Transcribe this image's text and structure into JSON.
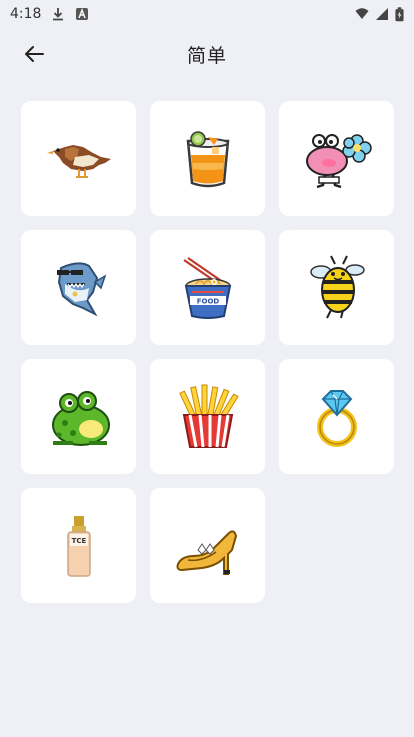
{
  "status": {
    "time": "4:18"
  },
  "header": {
    "title": "简单"
  },
  "items": [
    {
      "name": "bird"
    },
    {
      "name": "orange-drink"
    },
    {
      "name": "pink-flower-creature"
    },
    {
      "name": "shark"
    },
    {
      "name": "instant-noodles",
      "label": "FOOD"
    },
    {
      "name": "bee"
    },
    {
      "name": "frog"
    },
    {
      "name": "french-fries"
    },
    {
      "name": "diamond-ring"
    },
    {
      "name": "foundation-bottle",
      "label": "TCE"
    },
    {
      "name": "high-heel-shoe"
    }
  ]
}
